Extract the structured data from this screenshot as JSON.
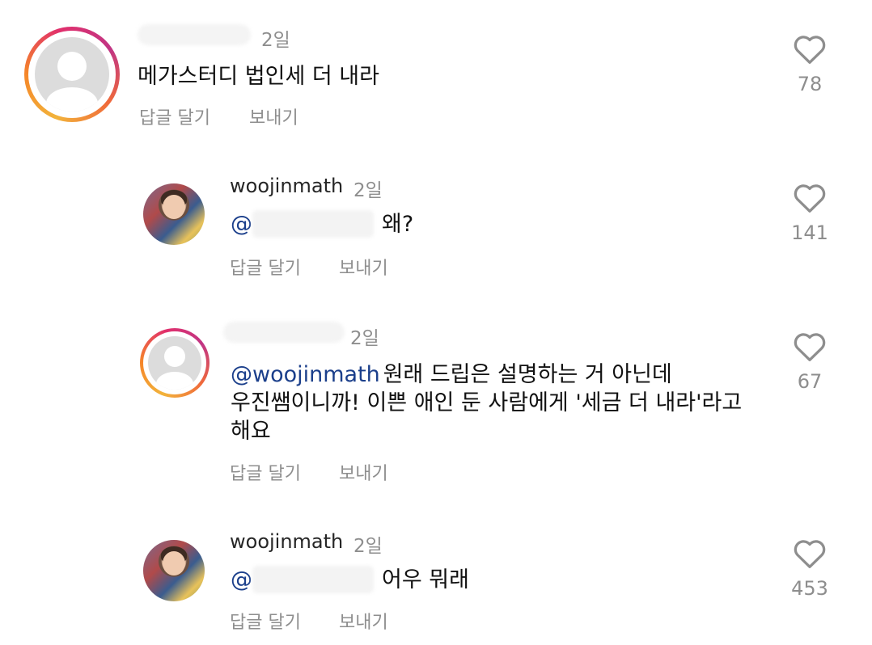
{
  "comments": [
    {
      "username": "",
      "time": "2일",
      "text": "메가스터디 법인세 더 내라",
      "reply_label": "답글 달기",
      "send_label": "보내기",
      "likes": "78"
    },
    {
      "username": "woojinmath",
      "time": "2일",
      "mention": "@",
      "text": "왜?",
      "reply_label": "답글 달기",
      "send_label": "보내기",
      "likes": "141"
    },
    {
      "username": "",
      "time": "2일",
      "mention": "@woojinmath",
      "text_line1": " 원래 드립은 설명하는 거 아닌데",
      "text_line2": "우진쌤이니까! 이쁜 애인 둔 사람에게 '세금 더 내라'라고",
      "text_line3": "해요",
      "reply_label": "답글 달기",
      "send_label": "보내기",
      "likes": "67"
    },
    {
      "username": "woojinmath",
      "time": "2일",
      "mention": "@",
      "text": "어우 뭐래",
      "reply_label": "답글 달기",
      "send_label": "보내기",
      "likes": "453"
    }
  ],
  "icons": {
    "heart": "heart-outline-icon",
    "default_avatar": "default-profile-icon"
  },
  "colors": {
    "text": "#111111",
    "secondary": "#8e8e8e",
    "mention": "#1b3f8b"
  }
}
